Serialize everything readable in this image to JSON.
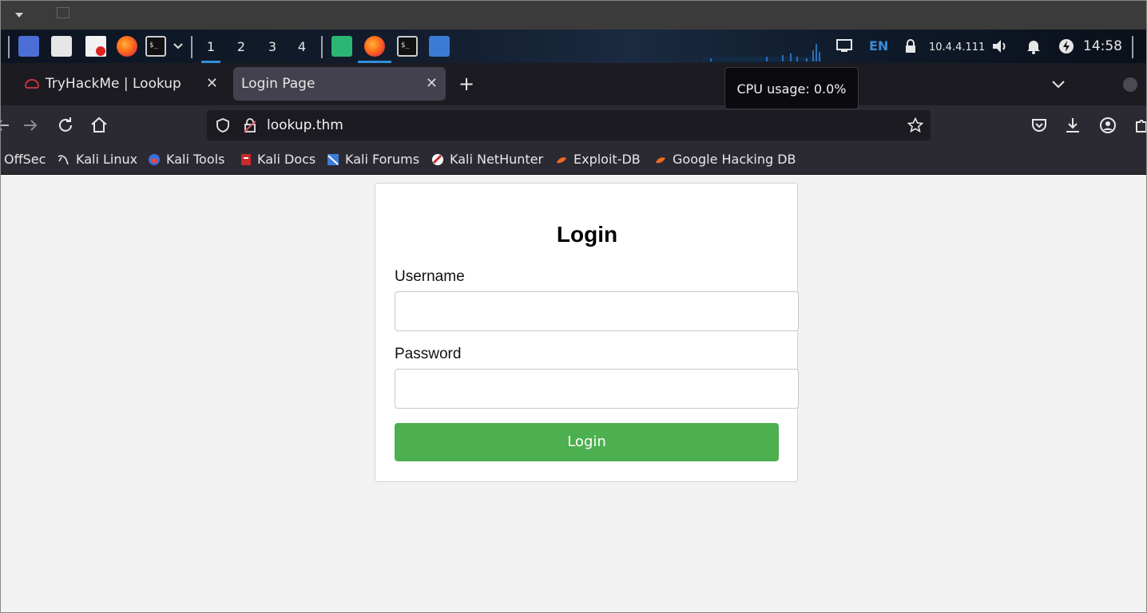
{
  "taskbar": {
    "workspaces": [
      "1",
      "2",
      "3",
      "4"
    ],
    "active_workspace": "1",
    "language": "EN",
    "ip": "10.4.4.111",
    "clock": "14:58"
  },
  "tabs": {
    "items": [
      {
        "title": "TryHackMe | Lookup",
        "active": false
      },
      {
        "title": "Login Page",
        "active": true
      }
    ],
    "close_glyph": "✕",
    "new_tab_glyph": "+"
  },
  "tooltip": {
    "text": "CPU usage: 0.0%"
  },
  "navbar": {
    "url": "lookup.thm"
  },
  "bookmarks": [
    "OffSec",
    "Kali Linux",
    "Kali Tools",
    "Kali Docs",
    "Kali Forums",
    "Kali NetHunter",
    "Exploit-DB",
    "Google Hacking DB"
  ],
  "login": {
    "title": "Login",
    "username_label": "Username",
    "username_value": "",
    "password_label": "Password",
    "password_value": "",
    "button_label": "Login"
  },
  "colors": {
    "accent_blue": "#2f8fde",
    "login_button": "#4caf50",
    "tab_active": "#42414d",
    "toolbar": "#2b2a33"
  }
}
